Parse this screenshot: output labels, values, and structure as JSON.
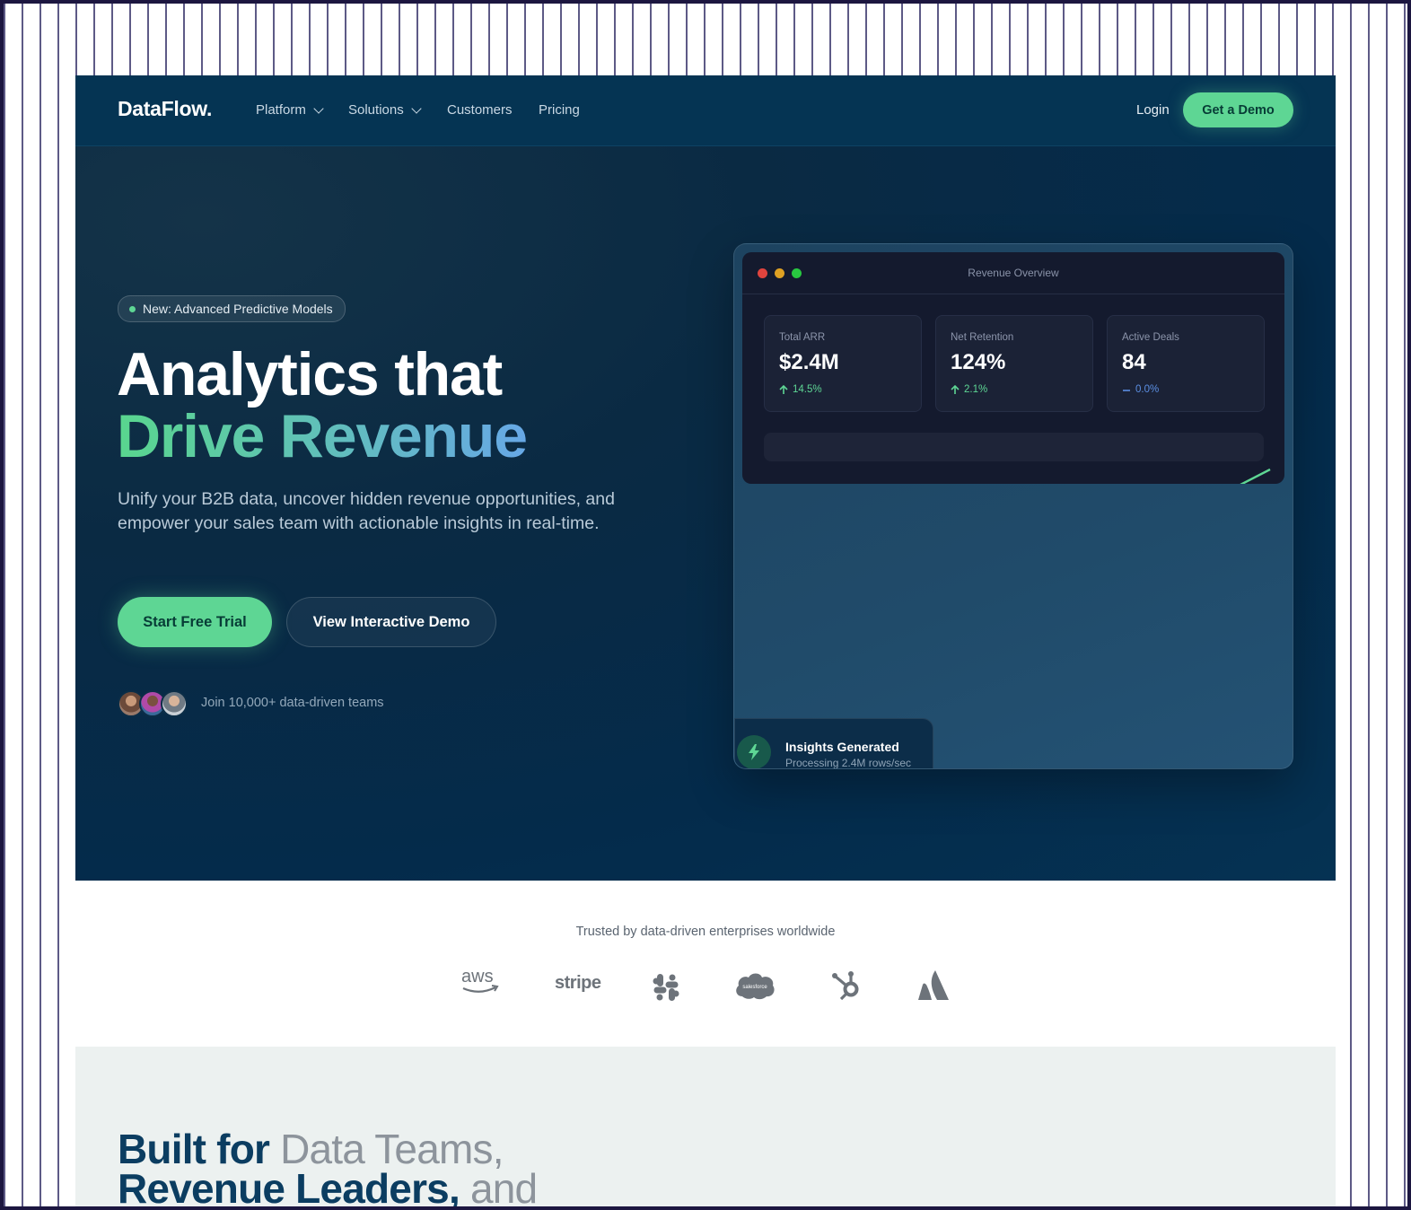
{
  "brand": "DataFlow.",
  "nav": {
    "items": [
      {
        "label": "Platform",
        "dropdown": true
      },
      {
        "label": "Solutions",
        "dropdown": true
      },
      {
        "label": "Customers",
        "dropdown": false
      },
      {
        "label": "Pricing",
        "dropdown": false
      }
    ],
    "login": "Login",
    "cta": "Get a Demo"
  },
  "hero": {
    "badge": "New: Advanced Predictive Models",
    "title_line1": "Analytics that",
    "title_line2": "Drive Revenue",
    "lede": "Unify your B2B data, uncover hidden revenue opportunities, and empower your sales team with actionable insights in real-time.",
    "primary_cta": "Start Free Trial",
    "secondary_cta": "View Interactive Demo",
    "social_proof": "Join 10,000+ data-driven teams"
  },
  "dashboard": {
    "title": "Revenue Overview",
    "kpis": [
      {
        "label": "Total ARR",
        "value": "$2.4M",
        "delta": "14.5%",
        "trend": "up"
      },
      {
        "label": "Net Retention",
        "value": "124%",
        "delta": "2.1%",
        "trend": "up"
      },
      {
        "label": "Active Deals",
        "value": "84",
        "delta": "0.0%",
        "trend": "flat"
      }
    ],
    "toast": {
      "title": "Insights Generated",
      "subtitle": "Processing 2.4M rows/sec"
    }
  },
  "trusted": {
    "label": "Trusted by data-driven enterprises worldwide",
    "logos": [
      "aws-logo",
      "stripe-logo",
      "slack-logo",
      "salesforce-logo",
      "hubspot-logo",
      "atlassian-logo"
    ],
    "aws_text": "aws",
    "stripe_text": "stripe",
    "salesforce_text": "salesforce"
  },
  "features": {
    "heading_bold_1": "Built for",
    "heading_light_1": "Data Teams,",
    "heading_bold_2": "Revenue Leaders,",
    "heading_light_2": "and"
  },
  "colors": {
    "accent": "#5ed694",
    "nav_bg": "#053453",
    "hero_bg": "#042b4b",
    "gradient_end": "#67a8e6",
    "card_bg": "#141a2e",
    "features_bg": "#ecf1f0"
  }
}
